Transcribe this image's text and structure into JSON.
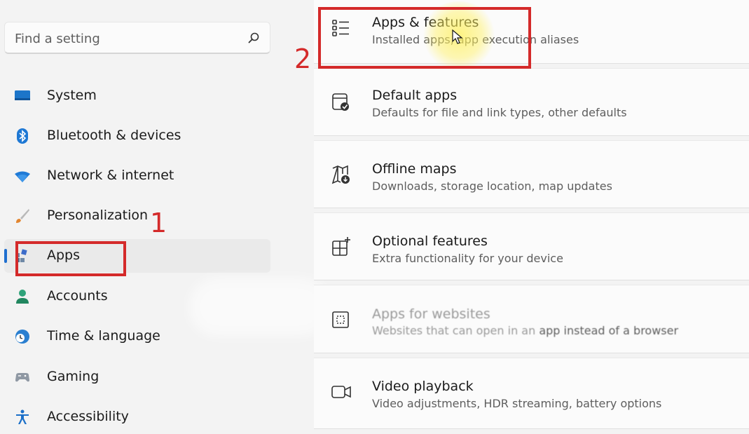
{
  "search": {
    "placeholder": "Find a setting",
    "icon": "search-icon"
  },
  "nav": {
    "items": [
      {
        "label": "System",
        "icon": "monitor-icon"
      },
      {
        "label": "Bluetooth & devices",
        "icon": "bluetooth-icon"
      },
      {
        "label": "Network & internet",
        "icon": "wifi-icon"
      },
      {
        "label": "Personalization",
        "icon": "brush-icon"
      },
      {
        "label": "Apps",
        "icon": "apps-icon",
        "selected": true
      },
      {
        "label": "Accounts",
        "icon": "person-icon"
      },
      {
        "label": "Time & language",
        "icon": "globe-clock-icon"
      },
      {
        "label": "Gaming",
        "icon": "gamepad-icon"
      },
      {
        "label": "Accessibility",
        "icon": "accessibility-icon"
      }
    ]
  },
  "cards": [
    {
      "title": "Apps & features",
      "desc": "Installed apps, app execution aliases",
      "icon": "list-icon"
    },
    {
      "title": "Default apps",
      "desc": "Defaults for file and link types, other defaults",
      "icon": "default-apps-icon"
    },
    {
      "title": "Offline maps",
      "desc": "Downloads, storage location, map updates",
      "icon": "map-download-icon"
    },
    {
      "title": "Optional features",
      "desc": "Extra functionality for your device",
      "icon": "add-grid-icon"
    },
    {
      "title": "Apps for websites",
      "desc_blurred": "Websites that can open in an",
      "desc_clear": "app instead of a browser",
      "icon": "web-app-icon"
    },
    {
      "title": "Video playback",
      "desc": "Video adjustments, HDR streaming, battery options",
      "icon": "video-icon"
    }
  ],
  "annotations": {
    "step1": "1",
    "step2": "2"
  },
  "colors": {
    "accent": "#1f6fcf",
    "annotation": "#d42a2a"
  }
}
